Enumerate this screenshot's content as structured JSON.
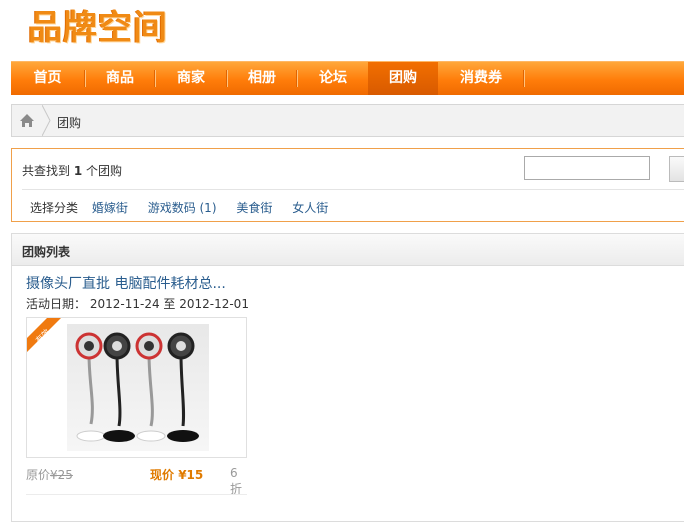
{
  "logo_text": "品牌空间",
  "nav": {
    "items": [
      "首页",
      "商品",
      "商家",
      "相册",
      "论坛",
      "团购",
      "消费券"
    ],
    "active_index": 5
  },
  "breadcrumb": {
    "label": "团购"
  },
  "search_summary": {
    "prefix": "共查找到",
    "count": "1",
    "suffix": "个团购"
  },
  "search": {
    "value": "",
    "placeholder": ""
  },
  "categories": {
    "label": "选择分类",
    "items": [
      "婚嫁街",
      "游戏数码 (1)",
      "美食街",
      "女人街"
    ]
  },
  "list": {
    "title": "团购列表",
    "items": [
      {
        "title": "摄像头厂直批 电脑配件耗材总...",
        "date_label": "活动日期：",
        "date_value": "2012-11-24 至 2012-12-01",
        "ribbon": "有效",
        "orig_label": "原价",
        "orig_price": "¥25",
        "now_label": "现价",
        "now_price": "¥15",
        "discount": "6折"
      }
    ]
  },
  "colors": {
    "accent": "#ff7d0a",
    "link": "#2a5d8e",
    "price": "#e07b00"
  }
}
